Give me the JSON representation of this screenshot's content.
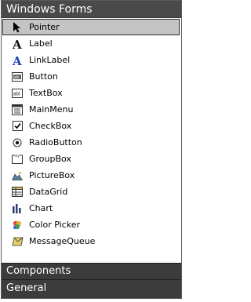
{
  "toolbox": {
    "active_section": "Windows Forms",
    "items": [
      {
        "label": "Pointer",
        "icon": "pointer-icon",
        "selected": true
      },
      {
        "label": "Label",
        "icon": "label-icon"
      },
      {
        "label": "LinkLabel",
        "icon": "linklabel-icon"
      },
      {
        "label": "Button",
        "icon": "button-icon"
      },
      {
        "label": "TextBox",
        "icon": "textbox-icon"
      },
      {
        "label": "MainMenu",
        "icon": "mainmenu-icon"
      },
      {
        "label": "CheckBox",
        "icon": "checkbox-icon"
      },
      {
        "label": "RadioButton",
        "icon": "radiobutton-icon"
      },
      {
        "label": "GroupBox",
        "icon": "groupbox-icon"
      },
      {
        "label": "PictureBox",
        "icon": "picturebox-icon"
      },
      {
        "label": "DataGrid",
        "icon": "datagrid-icon"
      },
      {
        "label": "Chart",
        "icon": "chart-icon"
      },
      {
        "label": "Color Picker",
        "icon": "color-picker-icon"
      },
      {
        "label": "MessageQueue",
        "icon": "messagequeue-icon"
      }
    ],
    "sections": {
      "components": "Components",
      "general": "General"
    }
  }
}
